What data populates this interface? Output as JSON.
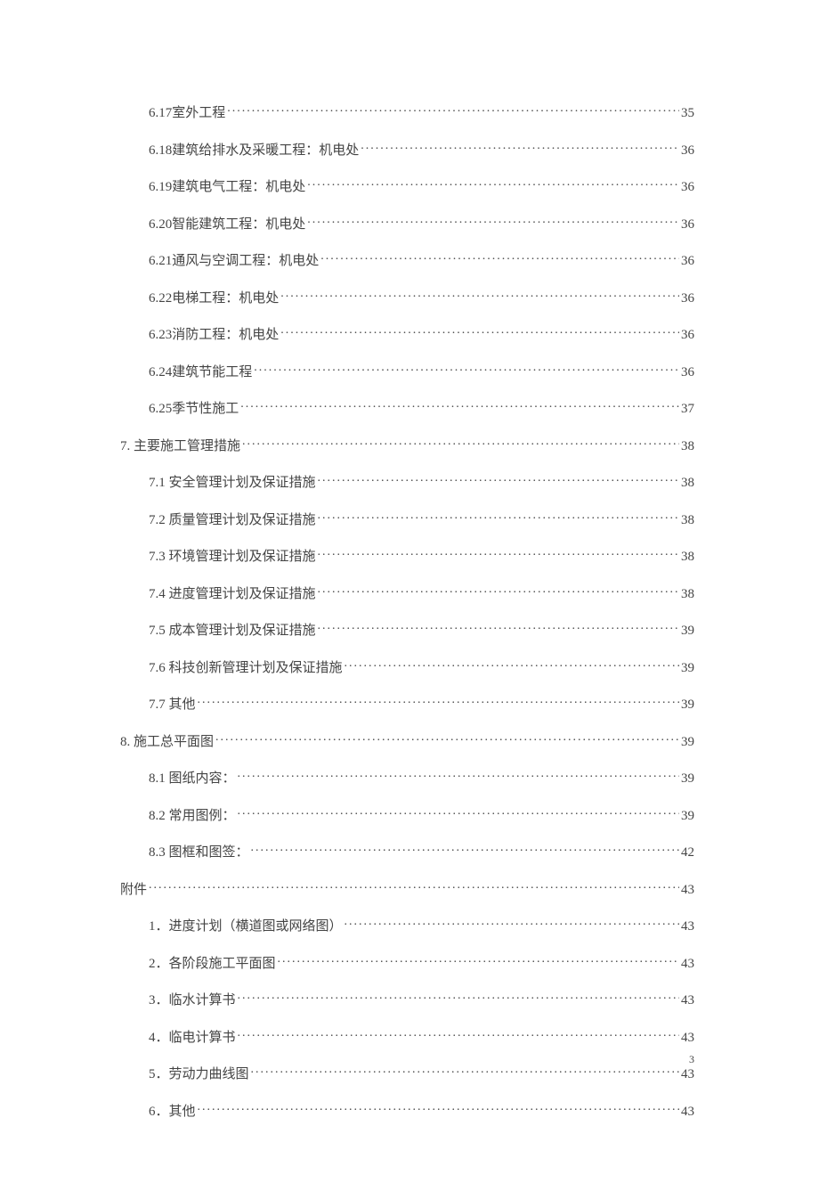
{
  "entries": [
    {
      "level": 2,
      "label": "6.17室外工程",
      "page": "35"
    },
    {
      "level": 2,
      "label": "6.18建筑给排水及采暖工程：机电处",
      "page": "36"
    },
    {
      "level": 2,
      "label": "6.19建筑电气工程：机电处",
      "page": "36"
    },
    {
      "level": 2,
      "label": "6.20智能建筑工程：机电处",
      "page": "36"
    },
    {
      "level": 2,
      "label": "6.21通风与空调工程：机电处",
      "page": "36"
    },
    {
      "level": 2,
      "label": "6.22电梯工程：机电处",
      "page": "36"
    },
    {
      "level": 2,
      "label": "6.23消防工程：机电处",
      "page": "36"
    },
    {
      "level": 2,
      "label": "6.24建筑节能工程",
      "page": "36"
    },
    {
      "level": 2,
      "label": "6.25季节性施工",
      "page": "37"
    },
    {
      "level": 1,
      "label": "7. 主要施工管理措施",
      "page": "38"
    },
    {
      "level": 2,
      "label": "7.1 安全管理计划及保证措施",
      "page": "38"
    },
    {
      "level": 2,
      "label": "7.2 质量管理计划及保证措施",
      "page": "38"
    },
    {
      "level": 2,
      "label": "7.3 环境管理计划及保证措施",
      "page": "38"
    },
    {
      "level": 2,
      "label": "7.4 进度管理计划及保证措施",
      "page": "38"
    },
    {
      "level": 2,
      "label": "7.5 成本管理计划及保证措施",
      "page": "39"
    },
    {
      "level": 2,
      "label": "7.6 科技创新管理计划及保证措施",
      "page": "39"
    },
    {
      "level": 2,
      "label": "7.7 其他",
      "page": "39"
    },
    {
      "level": 1,
      "label": "8. 施工总平面图",
      "page": "39"
    },
    {
      "level": 2,
      "label": "8.1 图纸内容：",
      "page": "39"
    },
    {
      "level": 2,
      "label": "8.2 常用图例：",
      "page": "39"
    },
    {
      "level": 2,
      "label": "8.3 图框和图签：",
      "page": "42"
    },
    {
      "level": 1,
      "label": "附件",
      "page": "43"
    },
    {
      "level": 2,
      "label": "1．进度计划（横道图或网络图）",
      "page": "43"
    },
    {
      "level": 2,
      "label": "2．各阶段施工平面图",
      "page": "43"
    },
    {
      "level": 2,
      "label": "3．临水计算书",
      "page": "43"
    },
    {
      "level": 2,
      "label": "4．临电计算书",
      "page": "43"
    },
    {
      "level": 2,
      "label": "5．劳动力曲线图",
      "page": "43"
    },
    {
      "level": 2,
      "label": "6．其他",
      "page": "43"
    }
  ],
  "page_number": "3"
}
